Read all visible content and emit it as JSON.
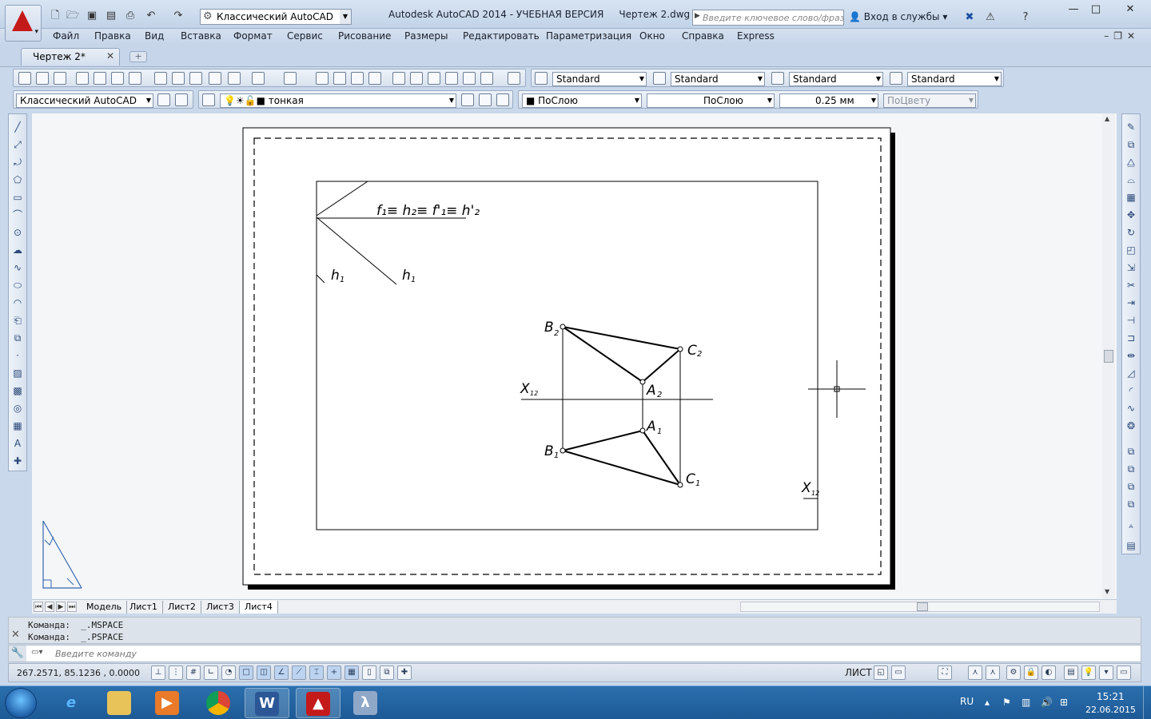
{
  "window": {
    "title": "Autodesk AutoCAD 2014 - УЧЕБНАЯ ВЕРСИЯ     Чертеж 2.dwg",
    "workspace": "Классический AutoCAD",
    "search_placeholder": "Введите ключевое слово/фразу",
    "signin": "Вход в службы"
  },
  "menu": [
    "Файл",
    "Правка",
    "Вид",
    "Вставка",
    "Формат",
    "Сервис",
    "Рисование",
    "Размеры",
    "Редактировать",
    "Параметризация",
    "Окно",
    "Справка",
    "Express"
  ],
  "tabs": {
    "document": "Чертеж 2*"
  },
  "toolbars": {
    "text_style": "Standard",
    "dim_style": "Standard",
    "table_style": "Standard",
    "mleader_style": "Standard",
    "workspace": "Классический AutoCAD",
    "layer": "тонкая",
    "color": "ПоСлою",
    "linetype": "ПоСлою",
    "lineweight": "0.25 мм",
    "plotstyle": "ПоЦвету"
  },
  "drawing": {
    "labels": {
      "planes": "f₁≡ h₂≡ f'₁≡ h'₂",
      "h1": "h",
      "h1_sub": "1",
      "h1p": "h",
      "h1p_sub": "1",
      "b2": "B",
      "b2_sub": "2",
      "c2": "C",
      "c2_sub": "2",
      "a2": "A",
      "a2_sub": "2",
      "a1": "A",
      "a1_sub": "1",
      "b1": "B",
      "b1_sub": "1",
      "c1": "C",
      "c1_sub": "1",
      "x12": "X",
      "x12_sub": "12",
      "x12b": "X",
      "x12b_sub": "12"
    }
  },
  "layout_tabs": [
    "Модель",
    "Лист1",
    "Лист2",
    "Лист3",
    "Лист4"
  ],
  "active_layout": "Лист4",
  "command": {
    "history": [
      "Команда:  _.MSPACE",
      "Команда:  _.PSPACE"
    ],
    "placeholder": "Введите команду"
  },
  "status": {
    "coords": "267.2571,  85.1236 , 0.0000",
    "space": "ЛИСТ"
  },
  "taskbar": {
    "lang": "RU",
    "time": "15:21",
    "date": "22.06.2015"
  }
}
